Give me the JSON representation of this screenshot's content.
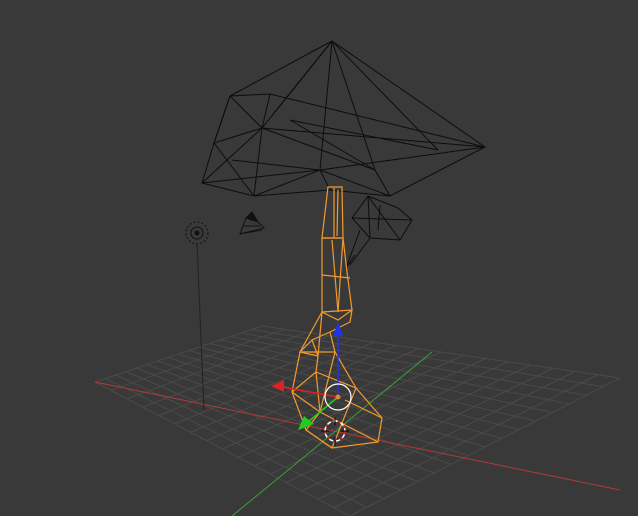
{
  "viewport": {
    "background": "#393939",
    "grid_color": "#4a4a4a",
    "x_axis_color": "#b23a3a",
    "y_axis_color": "#3aa03a"
  },
  "objects": {
    "canopy_mesh": {
      "icon": "wireframe-mesh",
      "color": "#0d0d0d"
    },
    "trunk_mesh": {
      "icon": "wireframe-mesh-selected",
      "color": "#f49a2c"
    },
    "lamp": {
      "icon": "lamp-icon"
    },
    "camera": {
      "icon": "camera-icon"
    }
  },
  "gizmo": {
    "x_color": "#dd2222",
    "y_color": "#22cc22",
    "z_color": "#2233ee"
  }
}
